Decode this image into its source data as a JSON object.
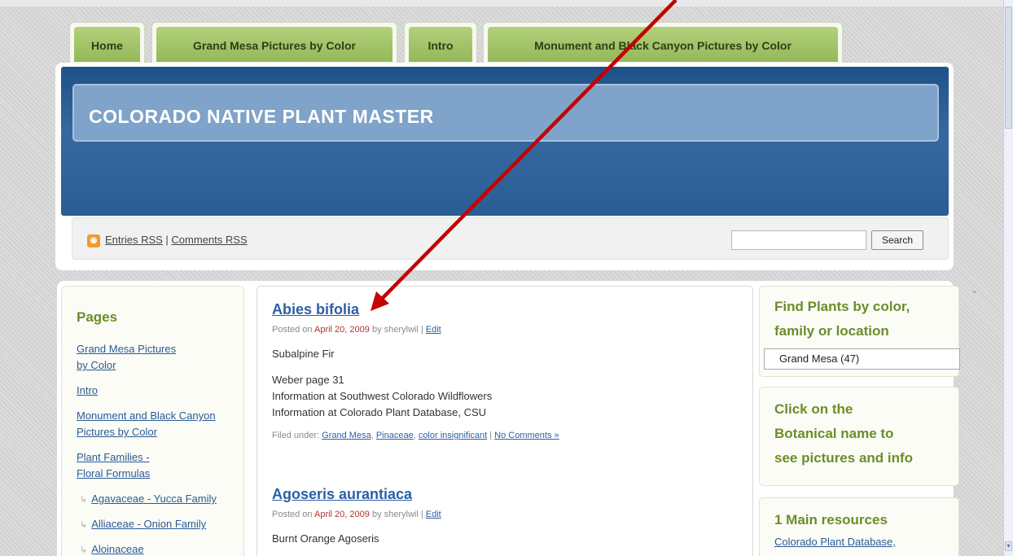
{
  "tabs": [
    "Home",
    "Grand Mesa Pictures by Color",
    "Intro",
    "Monument and Black Canyon Pictures by Color"
  ],
  "header": {
    "site_title": "COLORADO NATIVE PLANT MASTER",
    "rss_entries": "Entries RSS",
    "rss_separator": " | ",
    "rss_comments": "Comments RSS",
    "search_button": "Search",
    "search_value": ""
  },
  "sidebar_left": {
    "heading": "Pages",
    "items": [
      {
        "line1": "Grand Mesa Pictures",
        "line2": "by Color"
      },
      {
        "line1": "Intro",
        "line2": ""
      },
      {
        "line1": "Monument and Black Canyon",
        "line2": "Pictures by Color"
      },
      {
        "line1": "Plant Families -",
        "line2": "Floral Formulas"
      }
    ],
    "subitems": [
      "Agavaceae - Yucca Family",
      "Alliaceae - Onion Family",
      "Aloinaceae"
    ]
  },
  "posts": [
    {
      "title": "Abies bifolia",
      "posted_on": "Posted on ",
      "date": "April 20, 2009",
      "by": " by sherylwil | ",
      "edit": "Edit",
      "common_name": "Subalpine Fir",
      "lines": [
        "Weber page 31",
        "Information at Southwest Colorado Wildflowers",
        "Information at Colorado Plant Database, CSU"
      ],
      "filed_label": "Filed under: ",
      "categories": [
        "Grand Mesa",
        "Pinaceae",
        "color insignificant"
      ],
      "comments": "No Comments »"
    },
    {
      "title": "Agoseris aurantiaca",
      "posted_on": "Posted on ",
      "date": "April 20, 2009",
      "by": " by sherylwil | ",
      "edit": "Edit",
      "common_name": "Burnt Orange Agoseris"
    }
  ],
  "sidebar_right": {
    "find_heading_1": "Find Plants by color,",
    "find_heading_2": "family or location",
    "dropdown_value": "Grand Mesa  (47)",
    "click_line1": "Click on the",
    "click_line2": "Botanical name to",
    "click_line3": "see pictures and info",
    "resources_heading": "1 Main resources",
    "resources_link": "Colorado Plant Database,"
  },
  "colors": {
    "tab_green": "#a5c66c",
    "banner_blue": "#2a5d93",
    "heading_green": "#6d8c2a",
    "link_blue": "#2b5fa5",
    "annotation_red": "#c40000"
  }
}
